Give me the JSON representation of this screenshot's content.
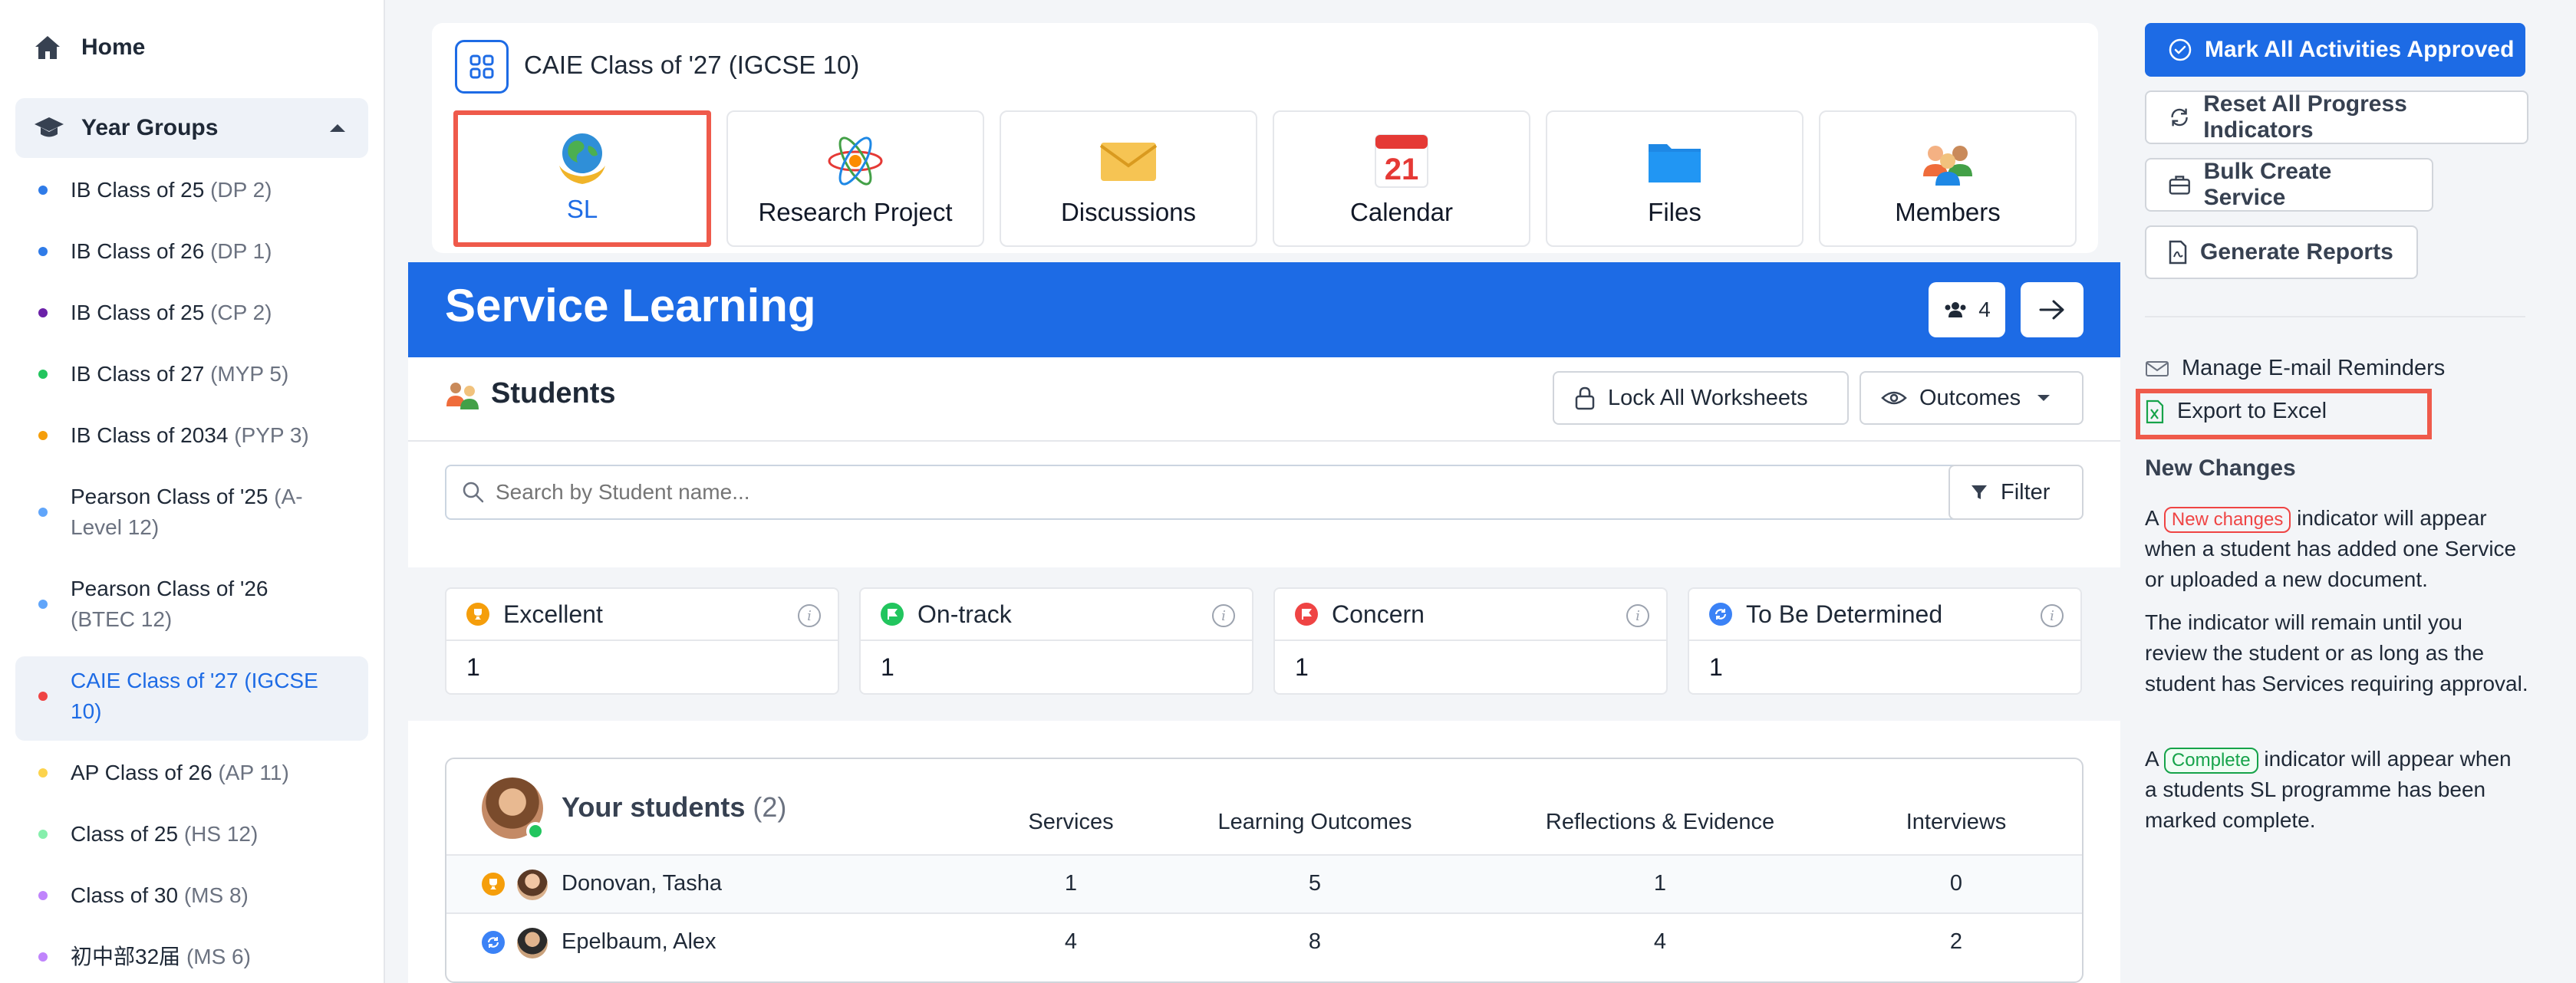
{
  "sidebar": {
    "home_label": "Home",
    "group_label": "Year Groups",
    "items": [
      {
        "label": "IB Class of 25",
        "sub": "(DP 2)",
        "dot": "#2f7be8"
      },
      {
        "label": "IB Class of 26",
        "sub": "(DP 1)",
        "dot": "#2f7be8"
      },
      {
        "label": "IB Class of 25",
        "sub": "(CP 2)",
        "dot": "#6b21a8"
      },
      {
        "label": "IB Class of 27",
        "sub": "(MYP 5)",
        "dot": "#22c55e"
      },
      {
        "label": "IB Class of 2034",
        "sub": "(PYP 3)",
        "dot": "#f59e0b"
      },
      {
        "label": "Pearson Class of '25",
        "sub": "(A-Level 12)",
        "dot": "#60a5fa"
      },
      {
        "label": "Pearson Class of '26",
        "sub": "(BTEC 12)",
        "dot": "#60a5fa"
      },
      {
        "label": "CAIE Class of '27",
        "sub": "(IGCSE 10)",
        "dot": "#ef4444"
      },
      {
        "label": "AP Class of 26",
        "sub": "(AP 11)",
        "dot": "#fcd34d"
      },
      {
        "label": "Class of 25",
        "sub": "(HS 12)",
        "dot": "#86efac"
      },
      {
        "label": "Class of 30",
        "sub": "(MS 8)",
        "dot": "#c084fc"
      },
      {
        "label": "初中部32届",
        "sub": "(MS 6)",
        "dot": "#c084fc"
      }
    ]
  },
  "class_header": {
    "title": "CAIE Class of '27 (IGCSE 10)",
    "tiles": [
      {
        "label": "SL",
        "icon": "globe-hands-icon",
        "emoji": "🌍"
      },
      {
        "label": "Research Project",
        "icon": "atom-icon",
        "emoji": "⚛"
      },
      {
        "label": "Discussions",
        "icon": "envelope-icon",
        "emoji": "✉"
      },
      {
        "label": "Calendar",
        "icon": "calendar-icon",
        "emoji": "21"
      },
      {
        "label": "Files",
        "icon": "folder-icon",
        "emoji": ""
      },
      {
        "label": "Members",
        "icon": "people-icon",
        "emoji": ""
      }
    ]
  },
  "banner": {
    "title": "Service Learning",
    "member_count": "4"
  },
  "students": {
    "title": "Students",
    "lock_label": "Lock All Worksheets",
    "outcomes_label": "Outcomes",
    "search_placeholder": "Search by Student name...",
    "filter_label": "Filter",
    "stats": [
      {
        "label": "Excellent",
        "value": "1",
        "color": "#f59e0b",
        "icon": "trophy-icon"
      },
      {
        "label": "On-track",
        "value": "1",
        "color": "#22c55e",
        "icon": "flag-icon"
      },
      {
        "label": "Concern",
        "value": "1",
        "color": "#ef4444",
        "icon": "flag-icon"
      },
      {
        "label": "To Be Determined",
        "value": "1",
        "color": "#3b82f6",
        "icon": "refresh-icon"
      }
    ]
  },
  "your_students": {
    "title": "Your students",
    "count": "(2)",
    "columns": [
      "Services",
      "Learning Outcomes",
      "Reflections & Evidence",
      "Interviews"
    ],
    "rows": [
      {
        "name": "Donovan, Tasha",
        "status_icon": "trophy-icon",
        "values": [
          "1",
          "5",
          "1",
          "0"
        ]
      },
      {
        "name": "Epelbaum, Alex",
        "status_icon": "refresh-icon",
        "values": [
          "4",
          "8",
          "4",
          "2"
        ]
      }
    ]
  },
  "actions": {
    "approve": "Mark All Activities Approved",
    "reset": "Reset All Progress Indicators",
    "bulk": "Bulk Create Service",
    "reports": "Generate Reports",
    "reminders": "Manage E-mail Reminders",
    "export": "Export to Excel"
  },
  "new_changes": {
    "title": "New Changes",
    "p1_a": "A",
    "p1_pill": "New changes",
    "p1_b": "indicator will appear when a student has added one Service or uploaded a new document.",
    "p2": "The indicator will remain until you review the student or as long as the student has Services requiring approval.",
    "p3_a": "A",
    "p3_pill": "Complete",
    "p3_b": "indicator will appear when a students SL programme has been marked complete."
  },
  "colors": {
    "accent": "#1d6be5",
    "highlight": "#ef5a4b"
  }
}
